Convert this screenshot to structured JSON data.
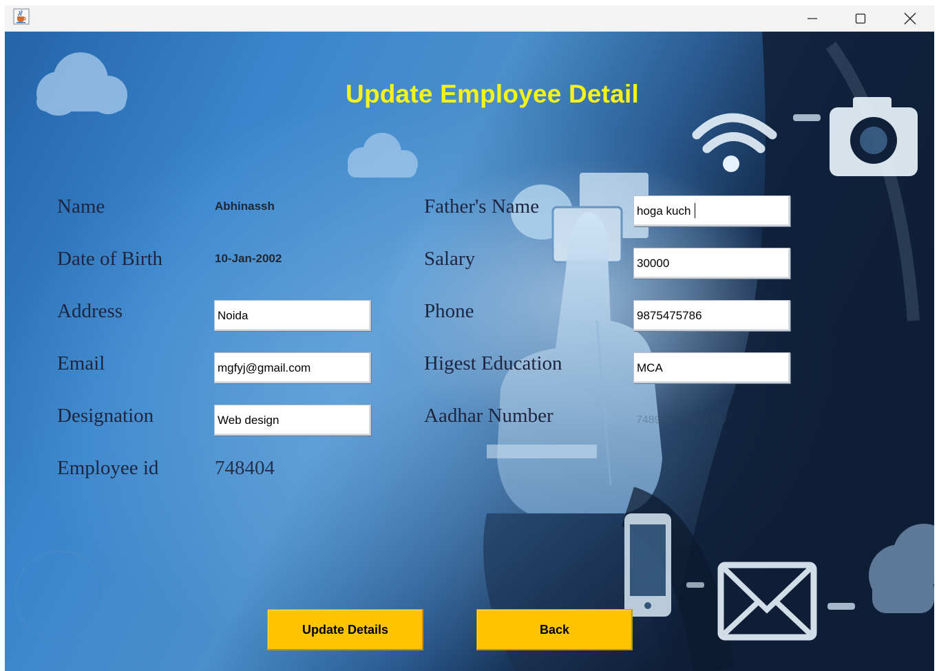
{
  "window": {
    "app_icon": "java-cup-icon",
    "controls": [
      "minimize-icon",
      "maximize-icon",
      "close-icon"
    ]
  },
  "form": {
    "title": "Update Employee Detail",
    "labels": {
      "name": "Name",
      "dob": "Date of Birth",
      "address": "Address",
      "email": "Email",
      "designation": "Designation",
      "employee_id": "Employee id",
      "fathers_name": "Father's Name",
      "salary": "Salary",
      "phone": "Phone",
      "education": "Higest Education",
      "aadhar": "Aadhar Number"
    },
    "values": {
      "name": "Abhinassh",
      "dob": "10-Jan-2002",
      "address": "Noida",
      "email": "mgfyj@gmail.com",
      "designation": "Web design",
      "employee_id": "748404",
      "fathers_name": "hoga kuch",
      "salary": "30000",
      "phone": "9875475786",
      "education": "MCA",
      "aadhar": "748967456876767"
    },
    "buttons": {
      "update": "Update Details",
      "back": "Back"
    }
  },
  "colors": {
    "title": "#f8f21b",
    "button": "#ffc300",
    "background_sky": "#2f74b8",
    "background_dark": "#0d1c33"
  }
}
